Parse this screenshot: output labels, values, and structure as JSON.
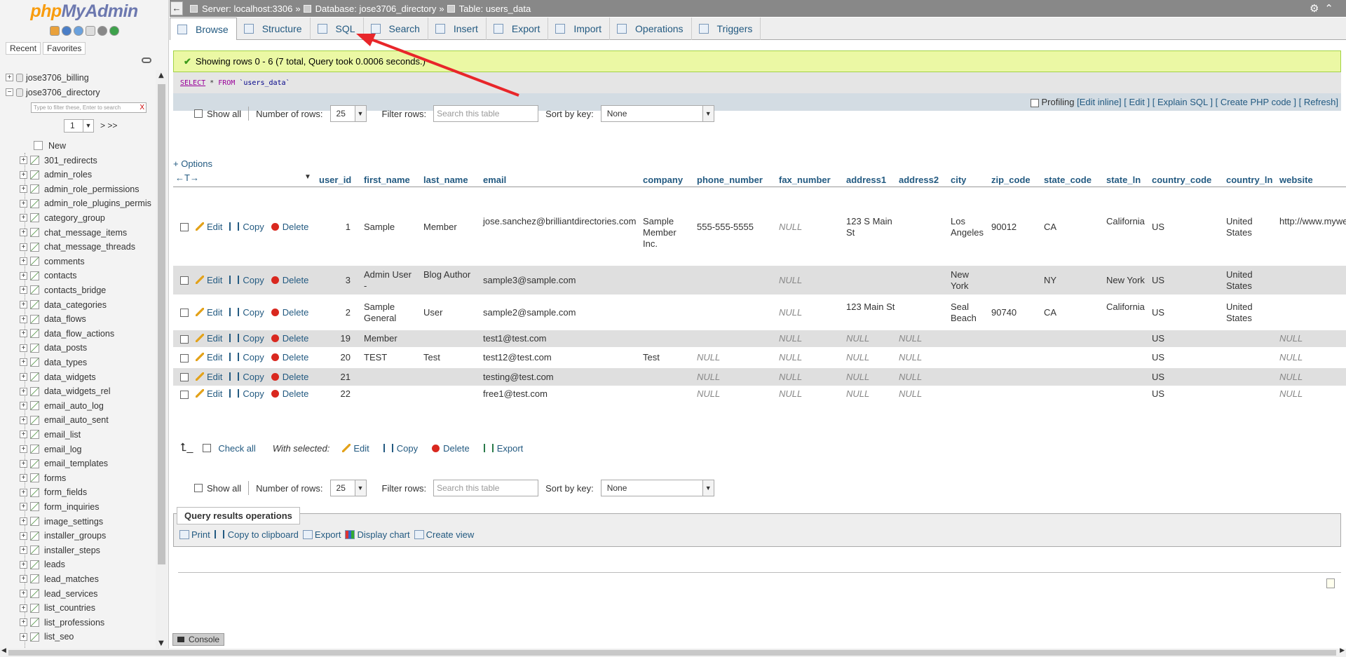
{
  "nav": {
    "logo_php": "php",
    "logo_ma": "MyAdmin",
    "tabs": [
      "Recent",
      "Favorites"
    ],
    "databases": [
      "jose3706_billing",
      "jose3706_directory"
    ],
    "filter_placeholder": "Type to filter these, Enter to search",
    "filter_clear": "X",
    "page_select": "1",
    "page_next": "> >>",
    "new_label": "New",
    "tables": [
      "301_redirects",
      "admin_roles",
      "admin_role_permissions",
      "admin_role_plugins_permis",
      "category_group",
      "chat_message_items",
      "chat_message_threads",
      "comments",
      "contacts",
      "contacts_bridge",
      "data_categories",
      "data_flows",
      "data_flow_actions",
      "data_posts",
      "data_types",
      "data_widgets",
      "data_widgets_rel",
      "email_auto_log",
      "email_auto_sent",
      "email_list",
      "email_log",
      "email_templates",
      "forms",
      "form_fields",
      "form_inquiries",
      "image_settings",
      "installer_groups",
      "installer_steps",
      "leads",
      "lead_matches",
      "lead_services",
      "list_countries",
      "list_professions",
      "list_seo"
    ]
  },
  "topbar": {
    "server": "Server: localhost:3306",
    "database": "Database: jose3706_directory",
    "table": "Table: users_data",
    "sep": "»"
  },
  "menu": [
    "Browse",
    "Structure",
    "SQL",
    "Search",
    "Insert",
    "Export",
    "Import",
    "Operations",
    "Triggers"
  ],
  "message": "Showing rows 0 - 6 (7 total, Query took 0.0006 seconds.)",
  "sql": {
    "select": "SELECT",
    "star": "*",
    "from": "FROM",
    "table": "`users_data`"
  },
  "sql_options": {
    "profiling": "Profiling",
    "links": [
      "[Edit inline]",
      "[ Edit ]",
      "[ Explain SQL ]",
      "[ Create PHP code ]",
      "[ Refresh]"
    ]
  },
  "navctrl": {
    "show_all": "Show all",
    "rows_label": "Number of rows:",
    "rows_value": "25",
    "filter_label": "Filter rows:",
    "filter_placeholder": "Search this table",
    "sort_label": "Sort by key:",
    "sort_value": "None"
  },
  "options_link": "+ Options",
  "columns": [
    "user_id",
    "first_name",
    "last_name",
    "email",
    "company",
    "phone_number",
    "fax_number",
    "address1",
    "address2",
    "city",
    "zip_code",
    "state_code",
    "state_ln",
    "country_code",
    "country_ln",
    "website"
  ],
  "actions": {
    "edit": "Edit",
    "copy": "Copy",
    "delete": "Delete"
  },
  "rows": [
    {
      "user_id": "1",
      "first_name": "Sample",
      "last_name": "Member",
      "email": "jose.sanchez@brilliantdirectories.com",
      "company": "Sample Member Inc.",
      "phone_number": "555-555-5555",
      "fax_number": "NULL",
      "address1": "123 S Main St",
      "address2": "",
      "city": "Los Angeles",
      "zip_code": "90012",
      "state_code": "CA",
      "state_ln": "California",
      "country_code": "US",
      "country_ln": "United States",
      "website": "http://www.mywe"
    },
    {
      "user_id": "3",
      "first_name": "Admin User -",
      "last_name": "Blog Author",
      "email": "sample3@sample.com",
      "company": "",
      "phone_number": "",
      "fax_number": "NULL",
      "address1": "",
      "address2": "",
      "city": "New York",
      "zip_code": "",
      "state_code": "NY",
      "state_ln": "New York",
      "country_code": "US",
      "country_ln": "United States",
      "website": ""
    },
    {
      "user_id": "2",
      "first_name": "Sample General",
      "last_name": "User",
      "email": "sample2@sample.com",
      "company": "",
      "phone_number": "",
      "fax_number": "NULL",
      "address1": "123 Main St",
      "address2": "",
      "city": "Seal Beach",
      "zip_code": "90740",
      "state_code": "CA",
      "state_ln": "California",
      "country_code": "US",
      "country_ln": "United States",
      "website": ""
    },
    {
      "user_id": "19",
      "first_name": "Member",
      "last_name": "",
      "email": "test1@test.com",
      "company": "",
      "phone_number": "",
      "fax_number": "NULL",
      "address1": "NULL",
      "address2": "NULL",
      "city": "",
      "zip_code": "",
      "state_code": "",
      "state_ln": "",
      "country_code": "US",
      "country_ln": "",
      "website": "NULL"
    },
    {
      "user_id": "20",
      "first_name": "TEST",
      "last_name": "Test",
      "email": "test12@test.com",
      "company": "Test",
      "phone_number": "NULL",
      "fax_number": "NULL",
      "address1": "NULL",
      "address2": "NULL",
      "city": "",
      "zip_code": "",
      "state_code": "",
      "state_ln": "",
      "country_code": "US",
      "country_ln": "",
      "website": "NULL"
    },
    {
      "user_id": "21",
      "first_name": "",
      "last_name": "",
      "email": "testing@test.com",
      "company": "",
      "phone_number": "NULL",
      "fax_number": "NULL",
      "address1": "NULL",
      "address2": "NULL",
      "city": "",
      "zip_code": "",
      "state_code": "",
      "state_ln": "",
      "country_code": "US",
      "country_ln": "",
      "website": "NULL"
    },
    {
      "user_id": "22",
      "first_name": "",
      "last_name": "",
      "email": "free1@test.com",
      "company": "",
      "phone_number": "NULL",
      "fax_number": "NULL",
      "address1": "NULL",
      "address2": "NULL",
      "city": "",
      "zip_code": "",
      "state_code": "",
      "state_ln": "",
      "country_code": "US",
      "country_ln": "",
      "website": "NULL"
    }
  ],
  "with_selected": {
    "check_all": "Check all",
    "label": "With selected:",
    "edit": "Edit",
    "copy": "Copy",
    "delete": "Delete",
    "export": "Export"
  },
  "query_ops": {
    "title": "Query results operations",
    "links": [
      "Print",
      "Copy to clipboard",
      "Export",
      "Display chart",
      "Create view"
    ]
  },
  "console": "Console",
  "colors": {
    "link": "#235a81",
    "success_bg": "#ebf8a4",
    "arrow": "#e8262a"
  }
}
